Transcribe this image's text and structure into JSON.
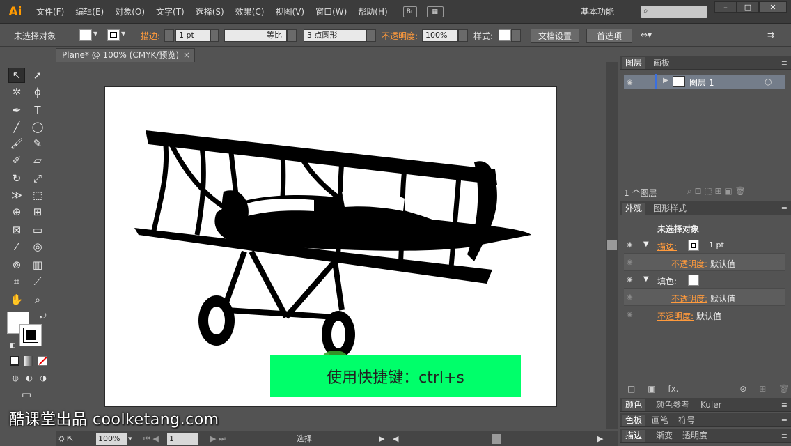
{
  "app": {
    "logo": "Ai",
    "menu": [
      "文件(F)",
      "编辑(E)",
      "对象(O)",
      "文字(T)",
      "选择(S)",
      "效果(C)",
      "视图(V)",
      "窗口(W)",
      "帮助(H)"
    ],
    "bridge_label": "Br",
    "workspace_label": "基本功能",
    "search_placeholder": "",
    "window_buttons": [
      "–",
      "□",
      "✕"
    ]
  },
  "control_bar": {
    "selection_status": "未选择对象",
    "stroke_label": "描边:",
    "stroke_weight": "1 pt",
    "stroke_profile": "等比",
    "brush_def": "3 点圆形",
    "opacity_label": "不透明度:",
    "opacity_value": "100%",
    "style_label": "样式:",
    "doc_setup_button": "文档设置",
    "preferences_button": "首选项"
  },
  "document": {
    "tab_title": "Plane* @ 100% (CMYK/预览)",
    "tab_close": "×"
  },
  "status_bar": {
    "zoom": "100%",
    "artboard_number": "1",
    "tool_status": "选择"
  },
  "layers_panel": {
    "tabs": [
      "图层",
      "画板"
    ],
    "layer_name": "图层 1",
    "layer_count": "1 个图层"
  },
  "appearance_panel": {
    "tabs": [
      "外观",
      "图形样式"
    ],
    "header": "未选择对象",
    "stroke_label": "描边:",
    "stroke_value": "1 pt",
    "opacity_label": "不透明度:",
    "opacity_default": "默认值",
    "fill_label": "填色:",
    "fx_label": "fx."
  },
  "bottom_panels": {
    "row1": [
      "颜色",
      "颜色参考",
      "Kuler"
    ],
    "row2": [
      "色板",
      "画笔",
      "符号"
    ],
    "row3": [
      "描边",
      "渐变",
      "透明度"
    ]
  },
  "overlay": {
    "shortcut_hint": "使用快捷键：ctrl+s",
    "watermark": "酷课堂出品 coolketang.com"
  }
}
